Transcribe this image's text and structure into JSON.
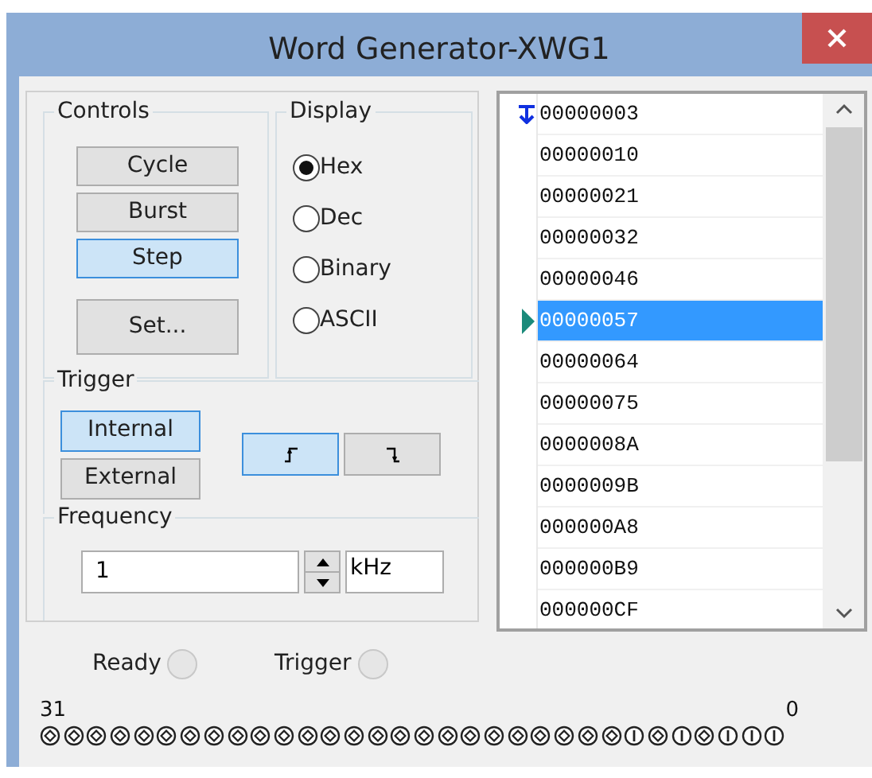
{
  "window": {
    "title": "Word Generator-XWG1"
  },
  "controls": {
    "title": "Controls",
    "buttons": [
      {
        "label": "Cycle",
        "selected": false
      },
      {
        "label": "Burst",
        "selected": false
      },
      {
        "label": "Step",
        "selected": true
      }
    ],
    "set_button": "Set..."
  },
  "display": {
    "title": "Display",
    "options": [
      {
        "label": "Hex",
        "selected": true
      },
      {
        "label": "Dec",
        "selected": false
      },
      {
        "label": "Binary",
        "selected": false
      },
      {
        "label": "ASCII",
        "selected": false
      }
    ]
  },
  "trigger": {
    "title": "Trigger",
    "sources": [
      {
        "label": "Internal",
        "selected": true
      },
      {
        "label": "External",
        "selected": false
      }
    ],
    "edges": [
      {
        "kind": "rising",
        "selected": true
      },
      {
        "kind": "falling",
        "selected": false
      }
    ]
  },
  "frequency": {
    "title": "Frequency",
    "value": "1",
    "unit": "kHz"
  },
  "words": [
    {
      "value": "00000003",
      "selected": false,
      "kind": "initial"
    },
    {
      "value": "00000010",
      "selected": false,
      "kind": "plain"
    },
    {
      "value": "00000021",
      "selected": false,
      "kind": "plain"
    },
    {
      "value": "00000032",
      "selected": false,
      "kind": "plain"
    },
    {
      "value": "00000046",
      "selected": false,
      "kind": "plain"
    },
    {
      "value": "00000057",
      "selected": true,
      "kind": "current"
    },
    {
      "value": "00000064",
      "selected": false,
      "kind": "plain"
    },
    {
      "value": "00000075",
      "selected": false,
      "kind": "plain"
    },
    {
      "value": "0000008A",
      "selected": false,
      "kind": "plain"
    },
    {
      "value": "0000009B",
      "selected": false,
      "kind": "plain"
    },
    {
      "value": "000000A8",
      "selected": false,
      "kind": "plain"
    },
    {
      "value": "000000B9",
      "selected": false,
      "kind": "plain"
    },
    {
      "value": "000000CF",
      "selected": false,
      "kind": "plain"
    }
  ],
  "indicators": [
    {
      "label": "Ready",
      "on": false
    },
    {
      "label": "Trigger",
      "on": false
    }
  ],
  "bits": {
    "high_label": "31",
    "low_label": "0",
    "pins": [
      {
        "on": false
      },
      {
        "on": false
      },
      {
        "on": false
      },
      {
        "on": false
      },
      {
        "on": false
      },
      {
        "on": false
      },
      {
        "on": false
      },
      {
        "on": false
      },
      {
        "on": false
      },
      {
        "on": false
      },
      {
        "on": false
      },
      {
        "on": false
      },
      {
        "on": false
      },
      {
        "on": false
      },
      {
        "on": false
      },
      {
        "on": false
      },
      {
        "on": false
      },
      {
        "on": false
      },
      {
        "on": false
      },
      {
        "on": false
      },
      {
        "on": false
      },
      {
        "on": false
      },
      {
        "on": false
      },
      {
        "on": false
      },
      {
        "on": false
      },
      {
        "on": true
      },
      {
        "on": false
      },
      {
        "on": true
      },
      {
        "on": false
      },
      {
        "on": true
      },
      {
        "on": true
      },
      {
        "on": true
      }
    ]
  }
}
